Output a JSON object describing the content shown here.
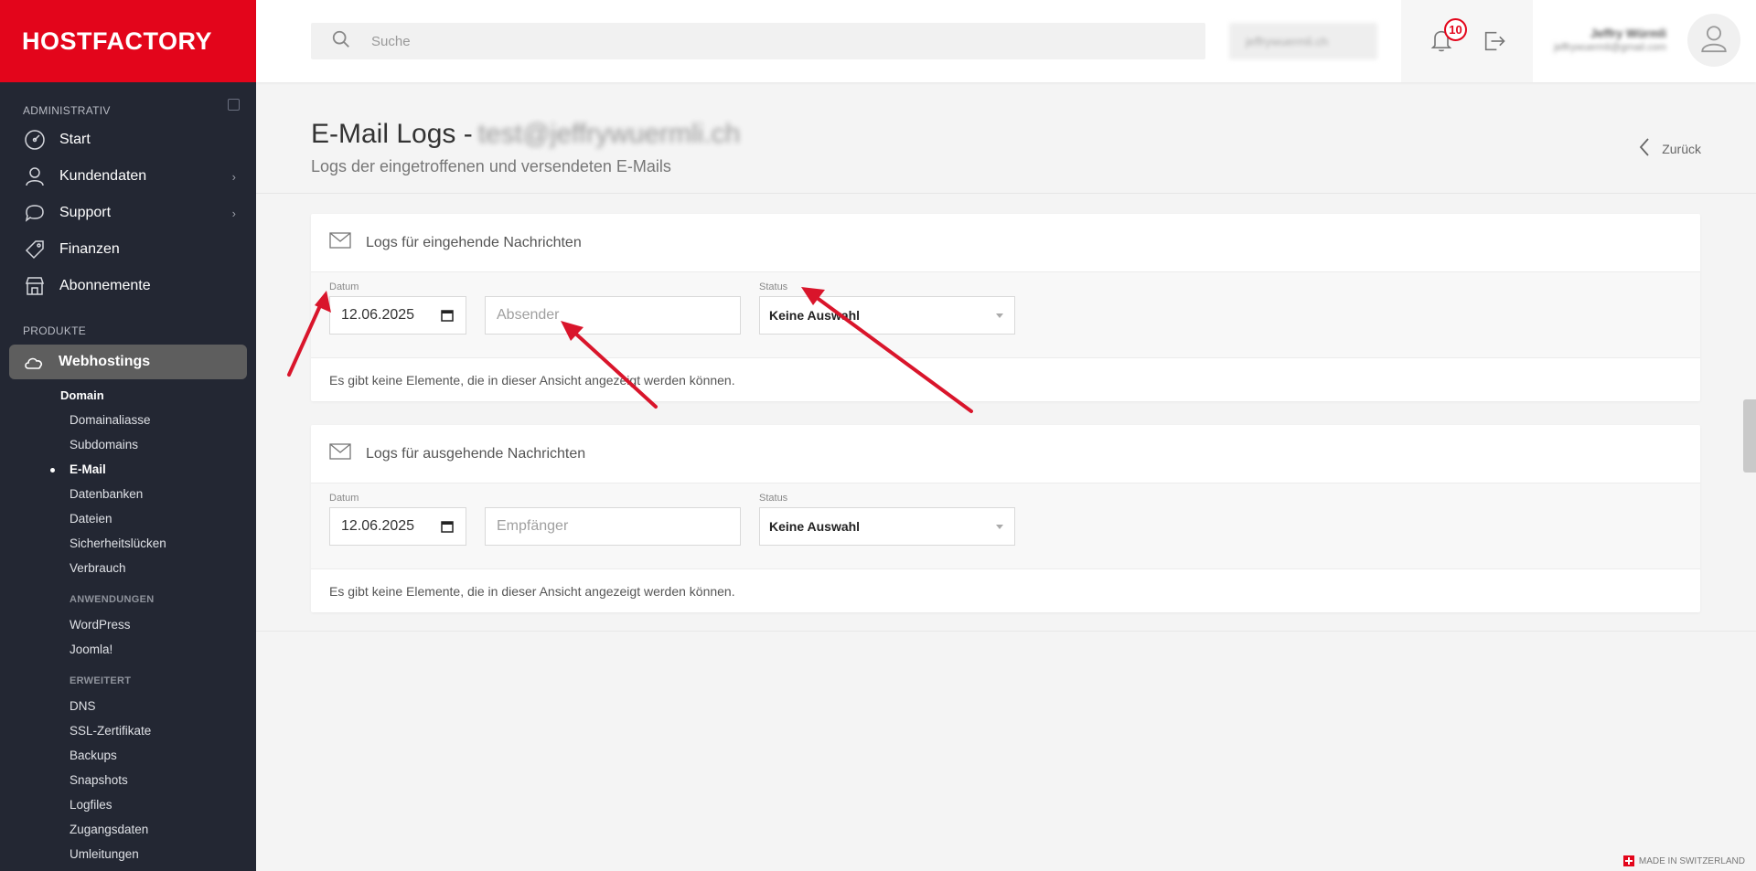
{
  "brand": {
    "logo_text": "HOSTFACTORY",
    "accent": "#e3051b"
  },
  "sidebar": {
    "section_admin": "ADMINISTRATIV",
    "admin_items": [
      {
        "label": "Start",
        "icon": "dashboard-icon"
      },
      {
        "label": "Kundendaten",
        "icon": "user-icon",
        "has_children": true
      },
      {
        "label": "Support",
        "icon": "chat-icon",
        "has_children": true
      },
      {
        "label": "Finanzen",
        "icon": "tag-icon"
      },
      {
        "label": "Abonnemente",
        "icon": "store-icon"
      }
    ],
    "section_products": "PRODUKTE",
    "active_product": {
      "label": "Webhostings",
      "icon": "cloud-icon"
    },
    "sub_head": "Domain",
    "domain_items": [
      "Domainaliasse",
      "Subdomains",
      "E-Mail",
      "Datenbanken",
      "Dateien",
      "Sicherheitslücken",
      "Verbrauch"
    ],
    "active_sub": "E-Mail",
    "group_apps": "ANWENDUNGEN",
    "app_items": [
      "WordPress",
      "Joomla!"
    ],
    "group_advanced": "ERWEITERT",
    "advanced_items": [
      "DNS",
      "SSL-Zertifikate",
      "Backups",
      "Snapshots",
      "Logfiles",
      "Zugangsdaten",
      "Umleitungen"
    ]
  },
  "topbar": {
    "search_placeholder": "Suche",
    "domain_value": "jeffrywuermli.ch",
    "notification_count": "10",
    "user_name": "Jeffry Würmli",
    "user_email": "jeffrywuermli@gmail.com"
  },
  "page": {
    "title": "E-Mail Logs -",
    "title_account": "test@jeffrywuermli.ch",
    "subtitle": "Logs der eingetroffenen und versendeten E-Mails",
    "back_label": "Zurück"
  },
  "incoming": {
    "title": "Logs für eingehende Nachrichten",
    "date_label": "Datum",
    "date_value": "12.06.2025",
    "text_placeholder": "Absender",
    "status_label": "Status",
    "status_value": "Keine Auswahl",
    "empty_message": "Es gibt keine Elemente, die in dieser Ansicht angezeigt werden können."
  },
  "outgoing": {
    "title": "Logs für ausgehende Nachrichten",
    "date_label": "Datum",
    "date_value": "12.06.2025",
    "text_placeholder": "Empfänger",
    "status_label": "Status",
    "status_value": "Keine Auswahl",
    "empty_message": "Es gibt keine Elemente, die in dieser Ansicht angezeigt werden können."
  },
  "footer": {
    "made_in": "MADE IN SWITZERLAND"
  },
  "annotation_color": "#d9152b"
}
